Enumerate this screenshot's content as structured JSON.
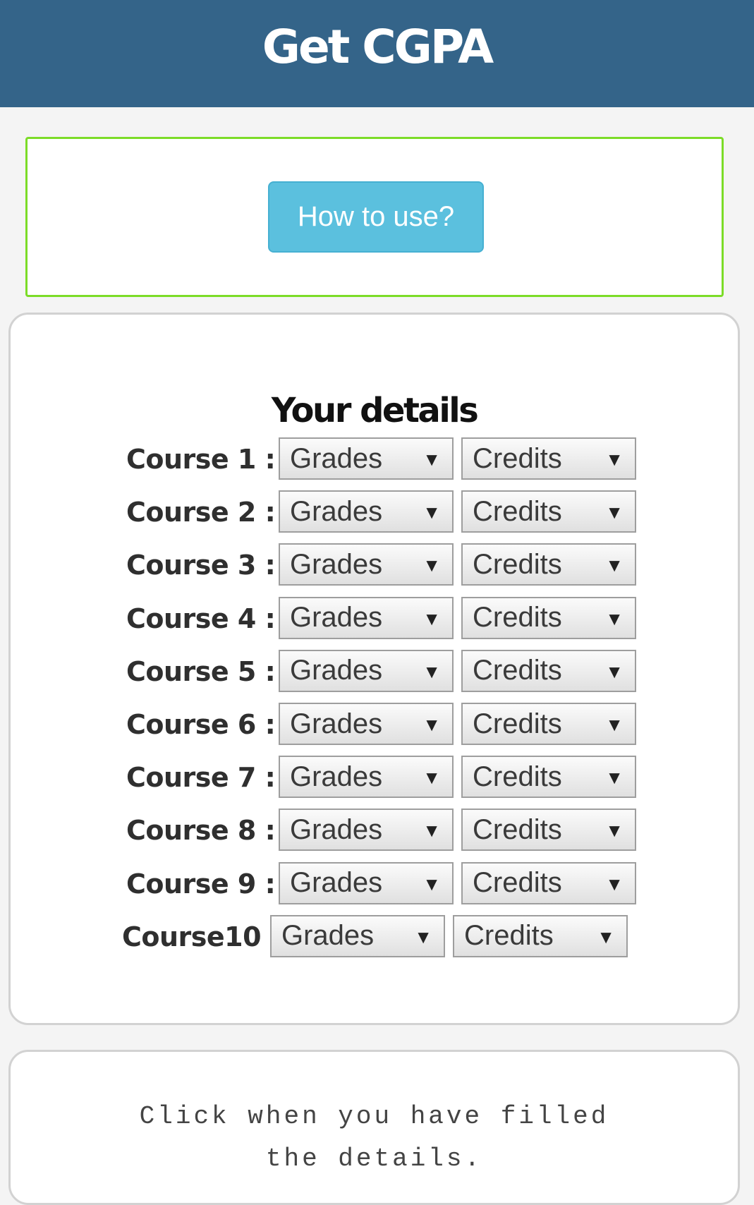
{
  "header": {
    "title": "Get CGPA"
  },
  "howto": {
    "button_label": "How to use?"
  },
  "details": {
    "title": "Your details",
    "courses": [
      {
        "label": "Course 1 :",
        "grade": "Grades",
        "credits": "Credits"
      },
      {
        "label": "Course 2 :",
        "grade": "Grades",
        "credits": "Credits"
      },
      {
        "label": "Course 3 :",
        "grade": "Grades",
        "credits": "Credits"
      },
      {
        "label": "Course 4 :",
        "grade": "Grades",
        "credits": "Credits"
      },
      {
        "label": "Course 5 :",
        "grade": "Grades",
        "credits": "Credits"
      },
      {
        "label": "Course 6 :",
        "grade": "Grades",
        "credits": "Credits"
      },
      {
        "label": "Course 7 :",
        "grade": "Grades",
        "credits": "Credits"
      },
      {
        "label": "Course 8 :",
        "grade": "Grades",
        "credits": "Credits"
      },
      {
        "label": "Course 9 :",
        "grade": "Grades",
        "credits": "Credits"
      },
      {
        "label": "Course10 :",
        "grade": "Grades",
        "credits": "Credits"
      }
    ],
    "dropdown_icon": "triangle-down-icon"
  },
  "submit": {
    "text": "Click when you have filled the details."
  },
  "colors": {
    "header_bg": "#346489",
    "howto_border": "#7cdc28",
    "button_bg": "#5bc0de"
  }
}
